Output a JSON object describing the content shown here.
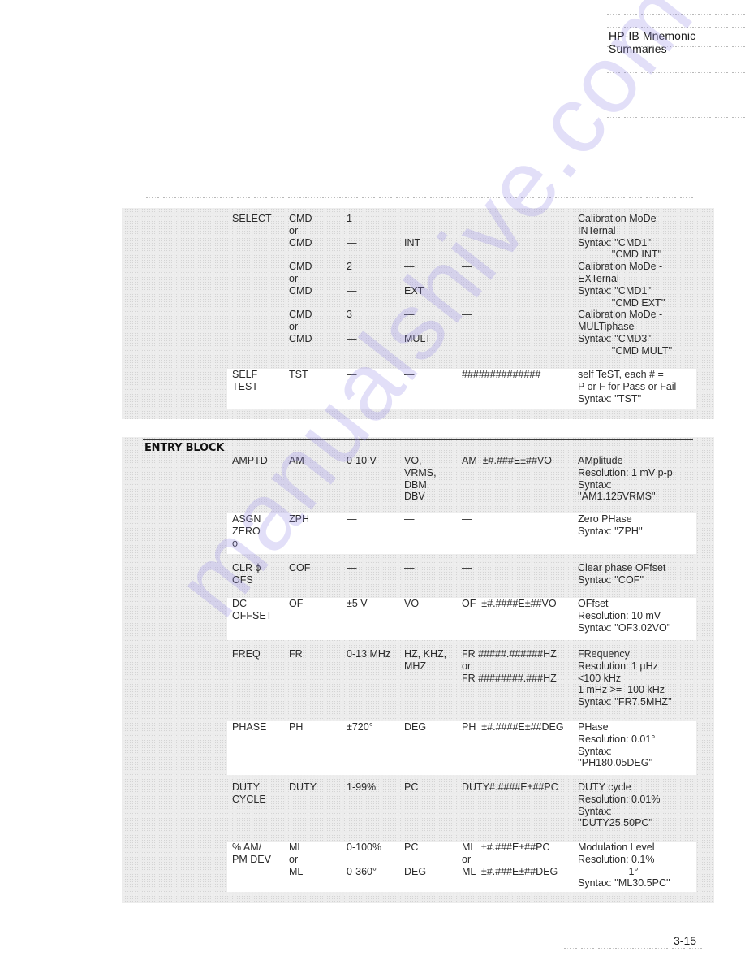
{
  "header": {
    "running_head": "HP-IB Mnemonic Summaries"
  },
  "footer": {
    "page_number": "3-15"
  },
  "watermark": "manualshive.com",
  "select_block": {
    "rows": [
      {
        "function": [
          "SELECT"
        ],
        "mnemonic": [
          "CMD",
          "or",
          "CMD",
          "",
          "CMD",
          "or",
          "CMD",
          "",
          "CMD",
          "or",
          "CMD"
        ],
        "range": [
          "1",
          "",
          "—",
          "",
          "2",
          "",
          "—",
          "",
          "3",
          "",
          "—"
        ],
        "units": [
          "—",
          "",
          "INT",
          "",
          "—",
          "",
          "EXT",
          "",
          "—",
          "",
          "MULT"
        ],
        "format": [
          "—",
          "",
          "",
          "",
          "—",
          "",
          "",
          "",
          "—"
        ],
        "description": [
          "Calibration MoDe -",
          "INTernal",
          "Syntax: ''CMD1''",
          "            ''CMD INT''",
          "Calibration MoDe -",
          "EXTernal",
          "Syntax: ''CMD1''",
          "            ''CMD EXT''",
          "Calibration MoDe -",
          "MULTiphase",
          "Syntax: ''CMD3''",
          "            ''CMD MULT''"
        ]
      },
      {
        "function": [
          "SELF",
          "TEST"
        ],
        "mnemonic": [
          "TST"
        ],
        "range": [
          "—"
        ],
        "units": [
          "—"
        ],
        "format": [
          "##############"
        ],
        "description": [
          "self TeST, each # =",
          "P or F for Pass or Fail",
          "Syntax: ''TST''"
        ]
      }
    ]
  },
  "entry_block": {
    "title": "ENTRY BLOCK",
    "rows": [
      {
        "function": [
          "AMPTD"
        ],
        "mnemonic": [
          "AM"
        ],
        "range": [
          "0-10 V"
        ],
        "units": [
          "VO,",
          "VRMS,",
          "DBM,",
          "DBV"
        ],
        "format": [
          "AM  ±#.###E±##VO"
        ],
        "description": [
          "AMplitude",
          "Resolution: 1 mV p-p",
          "Syntax:",
          "''AM1.125VRMS''"
        ]
      },
      {
        "function": [
          "ASGN",
          "ZERO",
          "ϕ"
        ],
        "mnemonic": [
          "ZPH"
        ],
        "range": [
          "—"
        ],
        "units": [
          "—"
        ],
        "format": [
          "—"
        ],
        "description": [
          "Zero PHase",
          "Syntax: ''ZPH''"
        ]
      },
      {
        "function": [
          "CLR ϕ",
          "OFS"
        ],
        "mnemonic": [
          "COF"
        ],
        "range": [
          "—"
        ],
        "units": [
          "—"
        ],
        "format": [
          "—"
        ],
        "description": [
          "Clear phase OFfset",
          "Syntax: ''COF''"
        ]
      },
      {
        "function": [
          "DC",
          "OFFSET"
        ],
        "mnemonic": [
          "OF"
        ],
        "range": [
          "±5 V"
        ],
        "units": [
          "VO"
        ],
        "format": [
          "OF  ±#.####E±##VO"
        ],
        "description": [
          "OFfset",
          "Resolution: 10 mV",
          "Syntax: ''OF3.02VO''"
        ]
      },
      {
        "function": [
          "FREQ"
        ],
        "mnemonic": [
          "FR"
        ],
        "range": [
          "0-13 MHz"
        ],
        "units": [
          "HZ, KHZ,",
          "MHZ"
        ],
        "format": [
          "FR #####.######HZ",
          "or",
          "FR ########.###HZ"
        ],
        "description": [
          "FRequency",
          "Resolution: 1 μHz",
          "<100 kHz",
          "1 mHz >=  100 kHz",
          "Syntax: ''FR7.5MHZ''"
        ]
      },
      {
        "function": [
          "PHASE"
        ],
        "mnemonic": [
          "PH"
        ],
        "range": [
          "±720°"
        ],
        "units": [
          "DEG"
        ],
        "format": [
          "PH  ±#.####E±##DEG"
        ],
        "description": [
          "PHase",
          "Resolution: 0.01°",
          "Syntax:",
          "''PH180.05DEG''"
        ]
      },
      {
        "function": [
          "DUTY",
          "CYCLE"
        ],
        "mnemonic": [
          "DUTY"
        ],
        "range": [
          "1-99%"
        ],
        "units": [
          "PC"
        ],
        "format": [
          "DUTY#.####E±##PC"
        ],
        "description": [
          "DUTY cycle",
          "Resolution: 0.01%",
          "Syntax:",
          "''DUTY25.50PC''"
        ]
      },
      {
        "function": [
          "% AM/",
          "PM DEV"
        ],
        "mnemonic": [
          "ML",
          "or",
          "ML"
        ],
        "range": [
          "0-100%",
          "",
          "0-360°"
        ],
        "units": [
          "PC",
          "",
          "DEG"
        ],
        "format": [
          "ML  ±#.###E±##PC",
          "or",
          "ML  ±#.###E±##DEG"
        ],
        "description": [
          "Modulation Level",
          "Resolution: 0.1%",
          "                  1°",
          "Syntax: ''ML30.5PC''"
        ]
      }
    ]
  }
}
